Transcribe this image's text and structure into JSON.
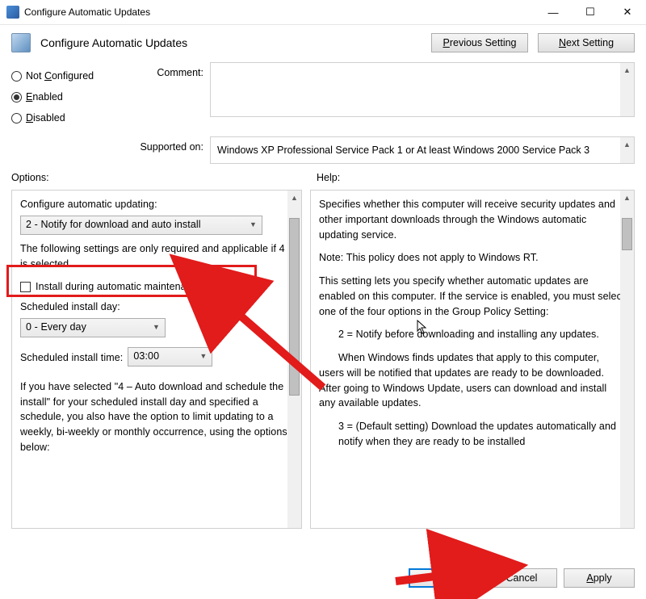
{
  "window": {
    "title": "Configure Automatic Updates"
  },
  "header": {
    "policy_title": "Configure Automatic Updates",
    "prev": "Previous Setting",
    "next": "Next Setting"
  },
  "state": {
    "not_configured": "Not Configured",
    "enabled": "Enabled",
    "disabled": "Disabled",
    "selected": "Enabled"
  },
  "labels": {
    "comment": "Comment:",
    "supported": "Supported on:",
    "options": "Options:",
    "help": "Help:"
  },
  "supported_text": "Windows XP Professional Service Pack 1 or At least Windows 2000 Service Pack 3",
  "options": {
    "heading": "Configure automatic updating:",
    "update_mode": "2 - Notify for download and auto install",
    "required_note": "The following settings are only required and applicable if 4 is selected.",
    "install_maint": "Install during automatic maintenance",
    "day_label": "Scheduled install day:",
    "day_value": "0 - Every day",
    "time_label": "Scheduled install time:",
    "time_value": "03:00",
    "footnote": "If you have selected \"4 – Auto download and schedule the install\" for your scheduled install day and specified a schedule, you also have the option to limit updating to a weekly, bi-weekly or monthly occurrence, using the options below:"
  },
  "help": {
    "p1": "Specifies whether this computer will receive security updates and other important downloads through the Windows automatic updating service.",
    "p2": "Note: This policy does not apply to Windows RT.",
    "p3": "This setting lets you specify whether automatic updates are enabled on this computer. If the service is enabled, you must select one of the four options in the Group Policy Setting:",
    "opt2_head": "2 = Notify before downloading and installing any updates.",
    "opt2_body": "When Windows finds updates that apply to this computer, users will be notified that updates are ready to be downloaded. After going to Windows Update, users can download and install any available updates.",
    "opt3_head": "3 = (Default setting) Download the updates automatically and notify when they are ready to be installed"
  },
  "footer": {
    "ok": "OK",
    "cancel": "Cancel",
    "apply": "Apply"
  }
}
